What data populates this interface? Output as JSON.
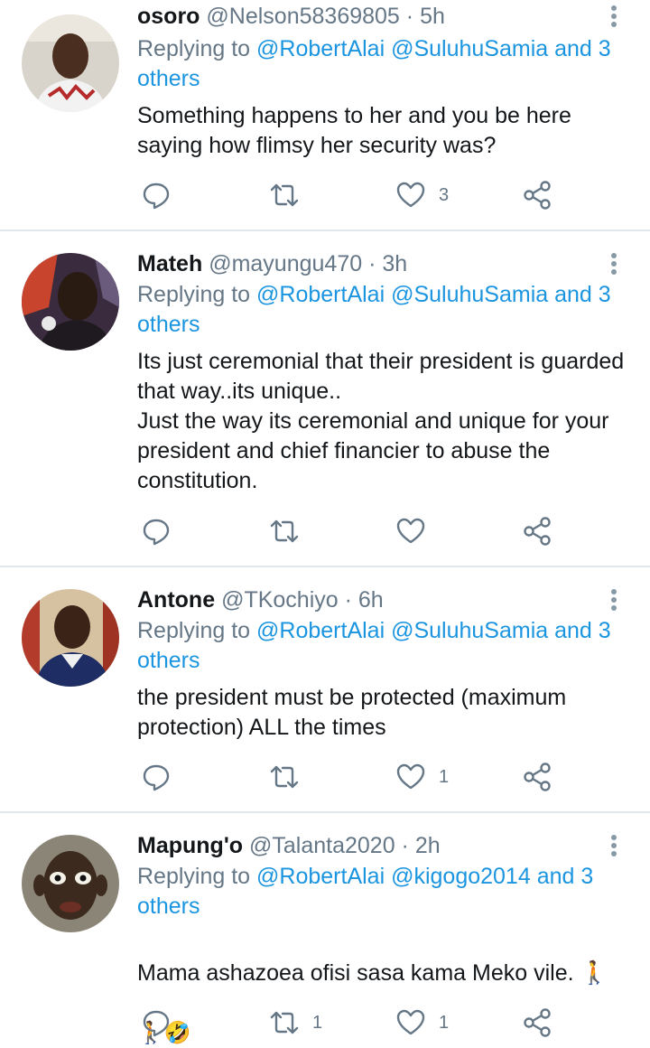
{
  "tweets": [
    {
      "name": "osoro",
      "handle": "@Nelson58369805",
      "time": "5h",
      "replying_prefix": "Replying to ",
      "replying_targets": "@RobertAlai @SuluhuSamia and 3 others",
      "text": "Something happens to her and you be here saying how flimsy her security was?",
      "comments": "",
      "retweets": "",
      "likes": "3"
    },
    {
      "name": "Mateh",
      "handle": "@mayungu470",
      "time": "3h",
      "replying_prefix": "Replying to ",
      "replying_targets": "@RobertAlai @SuluhuSamia and 3 others",
      "text": "Its just ceremonial that their president is guarded that way..its unique..\nJust the way its ceremonial and unique for your president and chief financier to abuse the constitution.",
      "comments": "",
      "retweets": "",
      "likes": ""
    },
    {
      "name": "Antone",
      "handle": "@TKochiyo",
      "time": "6h",
      "replying_prefix": "Replying to ",
      "replying_targets": "@RobertAlai @SuluhuSamia and 3 others",
      "text": "the president must be protected (maximum protection) ALL the times",
      "comments": "",
      "retweets": "",
      "likes": "1"
    },
    {
      "name": "Mapung'o",
      "handle": "@Talanta2020",
      "time": "2h",
      "replying_prefix": "Replying to ",
      "replying_targets": "@RobertAlai @kigogo2014 and 3 others",
      "text": "Mama ashazoea ofisi sasa kama Meko vile. 🚶",
      "text_line2": "🚶🤣",
      "comments": "",
      "retweets": "1",
      "likes": "1"
    }
  ],
  "separator": " · ",
  "icons": {
    "comment": "comment-icon",
    "retweet": "retweet-icon",
    "like": "heart-icon",
    "share": "share-icon",
    "more": "more-vertical-icon"
  },
  "colors": {
    "link": "#1b95e0",
    "secondary_text": "#657786",
    "icon": "#657786",
    "divider": "#e1e8ed"
  }
}
